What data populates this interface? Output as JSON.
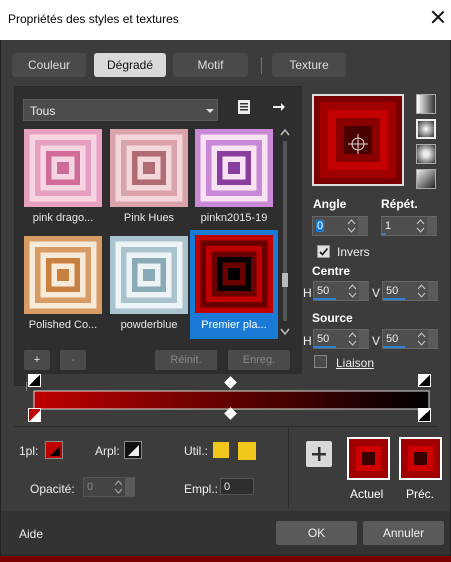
{
  "window": {
    "title": "Propriétés des styles et textures"
  },
  "tabs": [
    {
      "label": "Couleur",
      "active": false
    },
    {
      "label": "Dégradé",
      "active": true
    },
    {
      "label": "Motif",
      "active": false
    },
    {
      "label": "Texture",
      "active": false
    }
  ],
  "category": {
    "selected": "Tous"
  },
  "gradients": [
    {
      "label": "pink drago...",
      "colors": [
        "#e8a0c0",
        "#f6d5e2",
        "#d06c9a"
      ]
    },
    {
      "label": "Pink Hues",
      "colors": [
        "#d9a3ab",
        "#f3d7da",
        "#b06b74"
      ]
    },
    {
      "label": "pinkn2015-19",
      "colors": [
        "#c989d6",
        "#f7e3f4",
        "#8a3f9f"
      ]
    },
    {
      "label": "Polished Co...",
      "colors": [
        "#d79b63",
        "#f8ead8",
        "#c7803f"
      ]
    },
    {
      "label": "powderblue",
      "colors": [
        "#a9c4cf",
        "#eef4f5",
        "#8aaab7"
      ]
    },
    {
      "label": "Premier pla...",
      "colors": [
        "#c00000",
        "#6a0000",
        "#000000"
      ],
      "selected": true
    }
  ],
  "gradient_buttons": {
    "add": "+",
    "remove": "-",
    "reset": "Réinit.",
    "save": "Enreg."
  },
  "angle": {
    "label": "Angle",
    "value": "0"
  },
  "repeat": {
    "label": "Répét.",
    "value": "1"
  },
  "invert": {
    "label": "Invers",
    "checked": true
  },
  "center": {
    "label": "Centre",
    "h_label": "H",
    "h": "50",
    "v_label": "V",
    "v": "50"
  },
  "source": {
    "label": "Source",
    "h_label": "H",
    "h": "50",
    "v_label": "V",
    "v": "50"
  },
  "link": {
    "label": "Liaison",
    "checked": false
  },
  "stops": {
    "fg_label": "1pl:",
    "bg_label": "Arpl:",
    "user_label": "Util.:",
    "opacity_label": "Opacité:",
    "opacity_value": "0",
    "location_label": "Empl.:",
    "location_value": "0"
  },
  "swatches": {
    "current_label": "Actuel",
    "previous_label": "Préc."
  },
  "footer": {
    "help": "Aide",
    "ok": "OK",
    "cancel": "Annuler"
  },
  "colors": {
    "accent": "#1a7bd6",
    "gradient_start": "#c00000",
    "gradient_end": "#000000",
    "user_color": "#f2c71c"
  }
}
